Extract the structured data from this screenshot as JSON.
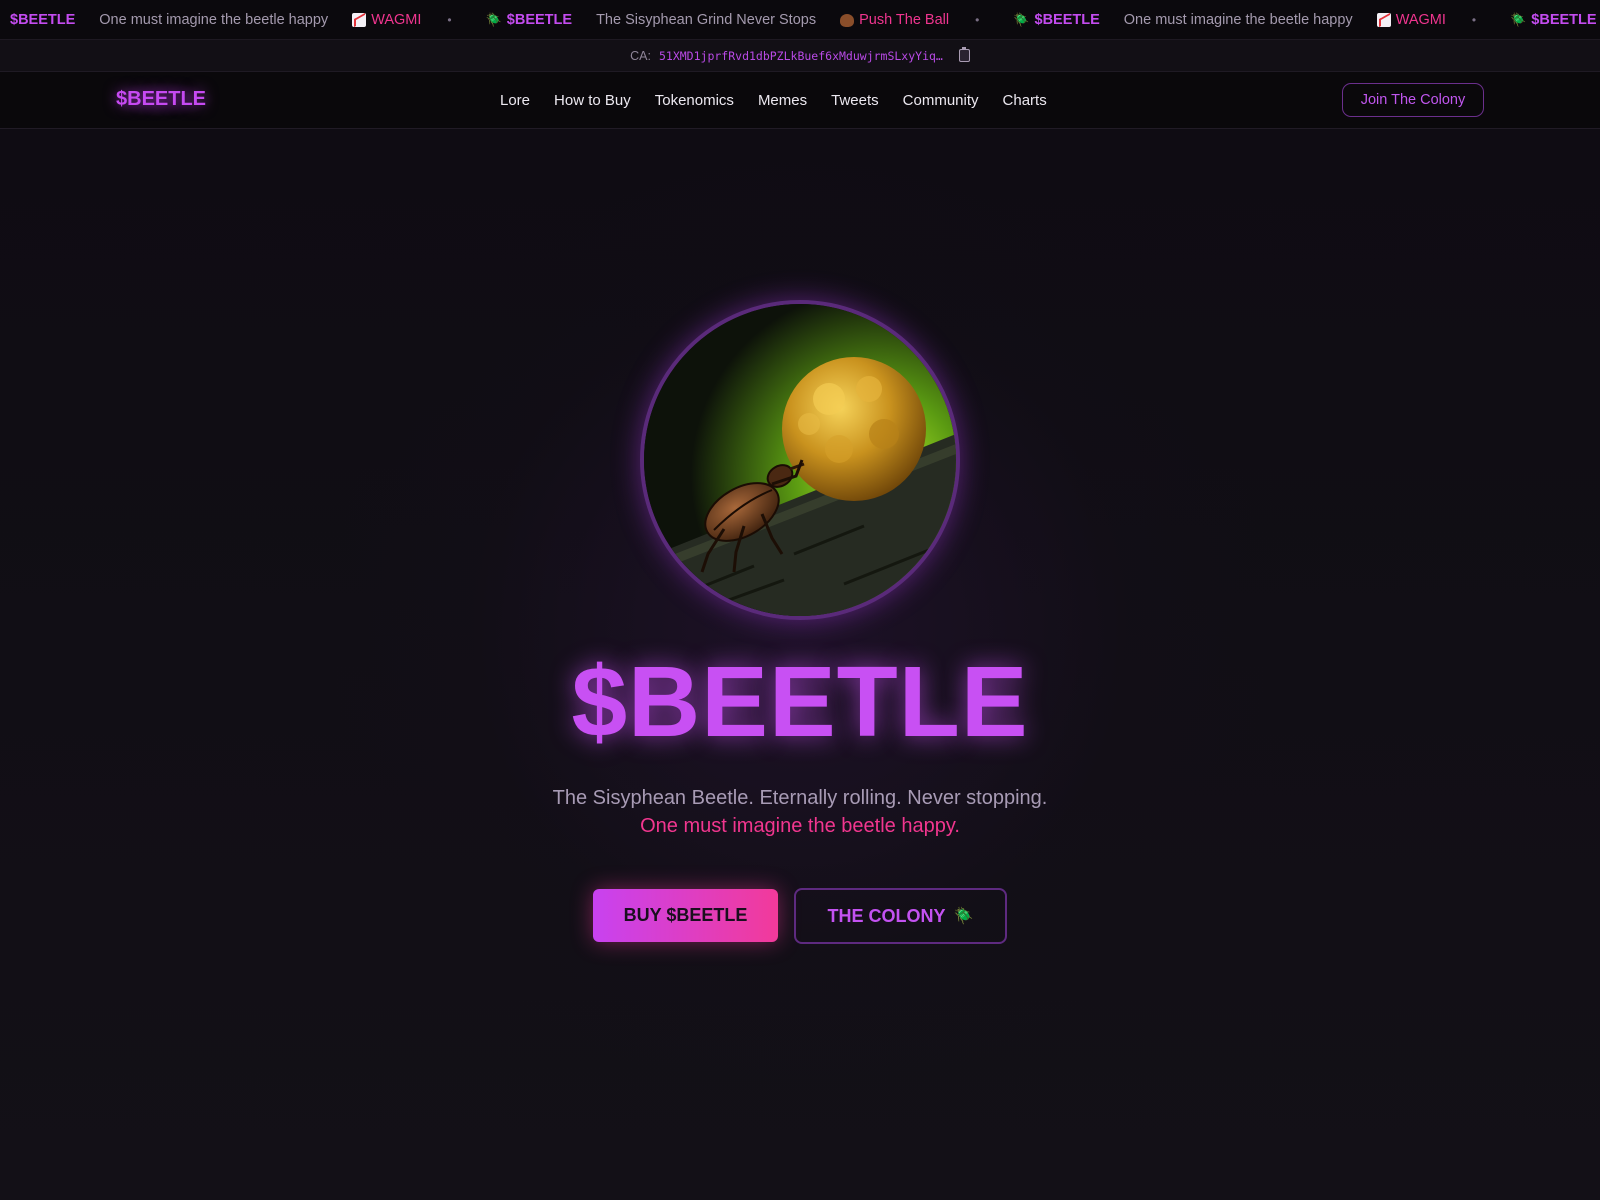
{
  "ticker": {
    "items": [
      {
        "type": "brand",
        "icon": "",
        "text": "$BEETLE"
      },
      {
        "type": "slogan",
        "icon": "",
        "text": "One must imagine the beetle happy"
      },
      {
        "type": "pink",
        "icon": "chart-increasing-icon",
        "text": "WAGMI"
      },
      {
        "type": "dot",
        "icon": "",
        "text": "•"
      },
      {
        "type": "brand",
        "icon": "beetle-icon",
        "text": "$BEETLE"
      },
      {
        "type": "slogan",
        "icon": "",
        "text": "The Sisyphean Grind Never Stops"
      },
      {
        "type": "pink",
        "icon": "poo-icon",
        "text": "Push The Ball"
      },
      {
        "type": "dot",
        "icon": "",
        "text": "•"
      },
      {
        "type": "brand",
        "icon": "beetle-icon",
        "text": "$BEETLE"
      },
      {
        "type": "slogan",
        "icon": "",
        "text": "One must imagine the beetle happy"
      },
      {
        "type": "pink",
        "icon": "chart-increasing-icon",
        "text": "WAGMI"
      },
      {
        "type": "dot",
        "icon": "",
        "text": "•"
      },
      {
        "type": "brand",
        "icon": "beetle-icon",
        "text": "$BEETLE"
      }
    ]
  },
  "ca": {
    "label": "CA:",
    "value": "51XMD1jprfRvd1dbPZLkBuef6xMduwjrmSLxyYiq…"
  },
  "header": {
    "logo": "$BEETLE",
    "nav": [
      "Lore",
      "How to Buy",
      "Tokenomics",
      "Memes",
      "Tweets",
      "Community",
      "Charts"
    ],
    "join_label": "Join The Colony"
  },
  "hero": {
    "title": "$BEETLE",
    "tagline1": "The Sisyphean Beetle. Eternally rolling. Never stopping.",
    "tagline2": "One must imagine the beetle happy.",
    "buy_label": "BUY $BEETLE",
    "colony_label": "THE COLONY",
    "colony_icon": "beetle-icon"
  },
  "colors": {
    "accent": "#c64af2",
    "pink": "#f0358f",
    "background": "#0f0d12"
  }
}
